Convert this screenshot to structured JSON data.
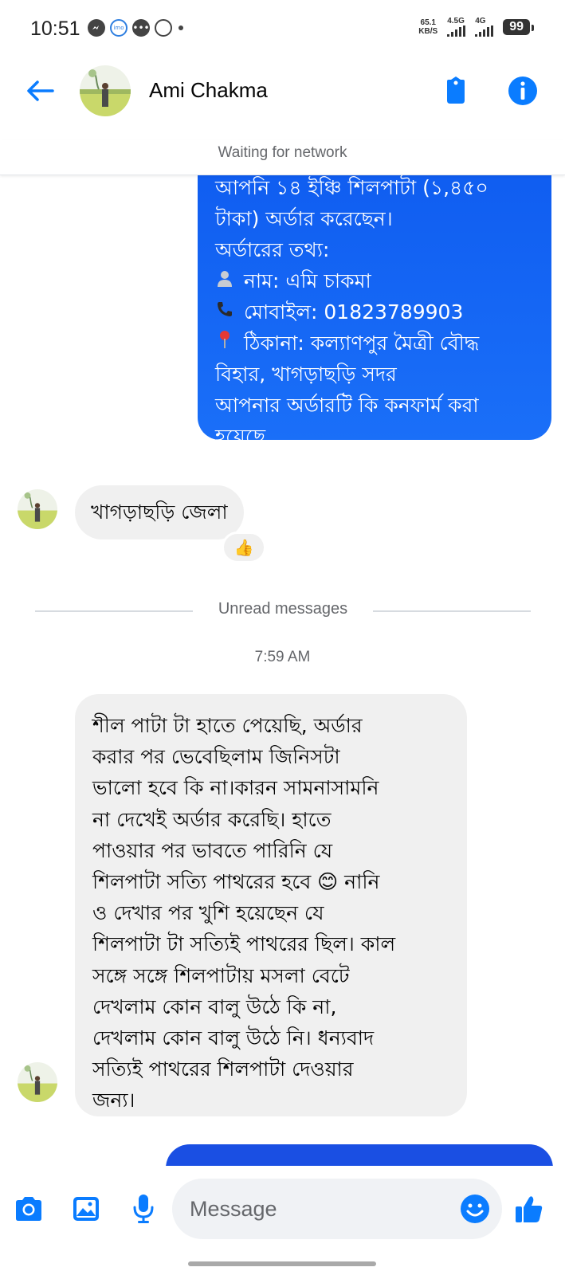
{
  "status_bar": {
    "time": "10:51",
    "speed_value": "65.1",
    "speed_unit": "KB/S",
    "network_1": "4.5G",
    "network_2": "4G",
    "battery": "99"
  },
  "header": {
    "contact_name": "Ami Chakma",
    "network_status": "Waiting for network"
  },
  "messages": {
    "outgoing_1_lines": [
      "আপনি ১৪ ইঞ্চি শিলপাটা (১,৪৫০",
      "টাকা) অর্ডার করেছেন।",
      "অর্ডারের তথ্য:",
      "নাম: এমি চাকমা",
      "মোবাইল: 01823789903",
      "ঠিকানা: কল্যাণপুর মৈত্রী বৌদ্ধ",
      "বিহার, খাগড়াছড়ি সদর",
      "আপনার অর্ডারটি কি কনফার্ম করা",
      "হয়েছে"
    ],
    "incoming_1": "খাগড়াছড়ি জেলা",
    "incoming_1_reaction": "👍",
    "unread_divider": "Unread messages",
    "timestamp": "7:59 AM",
    "incoming_2_lines": [
      "শীল পাটা টা হাতে পেয়েছি, অর্ডার",
      "করার পর ভেবেছিলাম  জিনিসটা",
      "ভালো হবে কি না।কারন সামনাসামনি",
      "না দেখেই অর্ডার করেছি। হাতে",
      "পাওয়ার পর ভাবতে পারিনি যে",
      "শিলপাটা সত্যি পাথরের হবে 😊 নানি",
      "ও দেখার পর খুশি হয়েছেন যে",
      "শিলপাটা টা সত্যিই পাথরের ছিল। কাল",
      "সঙ্গে সঙ্গে শিলপাটায় মসলা বেটে",
      "দেখলাম কোন বালু উঠে কি না,",
      "দেখলাম কোন বালু উঠে নি। ধন্যবাদ",
      "সত্যিই পাথরের শিলপাটা দেওয়ার",
      "জন্য।"
    ]
  },
  "composer": {
    "placeholder": "Message"
  },
  "colors": {
    "accent": "#0a7cff",
    "outgoing_bubble": "#1064f2",
    "incoming_bubble": "#f0f0f0"
  },
  "icons": {
    "back": "arrow-left-icon",
    "tag": "tag-icon",
    "info": "info-icon",
    "camera": "camera-icon",
    "gallery": "image-icon",
    "mic": "microphone-icon",
    "emoji": "smiley-icon",
    "like": "thumbs-up-icon"
  }
}
